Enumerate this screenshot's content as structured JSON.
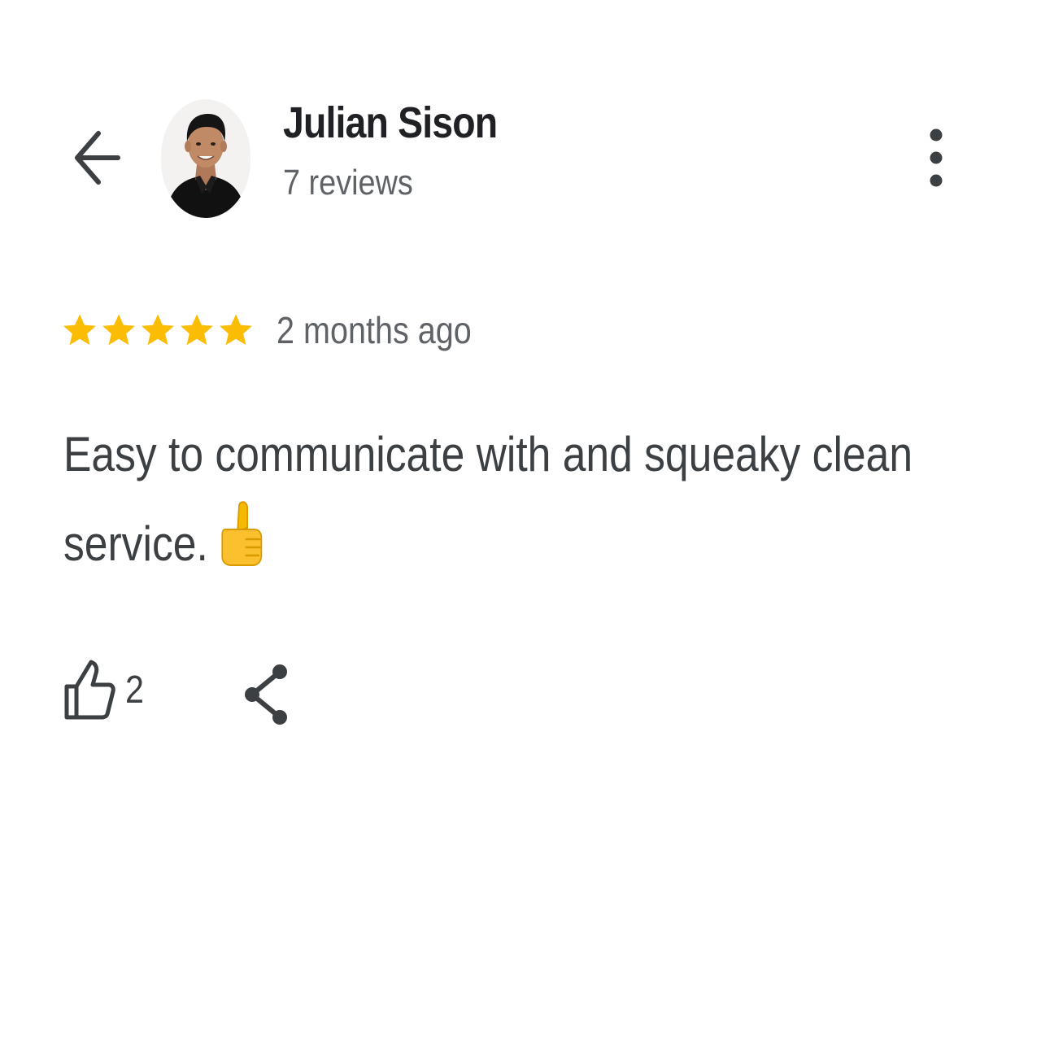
{
  "header": {
    "back_icon": "arrow-back-icon",
    "author_name": "Julian Sison",
    "review_count": "7 reviews",
    "more_icon": "more-vert-icon"
  },
  "review": {
    "rating": 5,
    "rating_max": 5,
    "star_color": "#fbbc04",
    "date": "2 months ago",
    "text_line_1": "Easy to communicate with and squeaky clean",
    "text_line_2": "service.",
    "emoji_icon": "thumbs-up-emoji"
  },
  "actions": {
    "like_icon": "thumb-up-outline-icon",
    "like_count": "2",
    "share_icon": "share-icon"
  },
  "colors": {
    "primary_text": "#202124",
    "secondary_text": "#5f6368",
    "body_text": "#3c4043",
    "star": "#fbbc04"
  }
}
